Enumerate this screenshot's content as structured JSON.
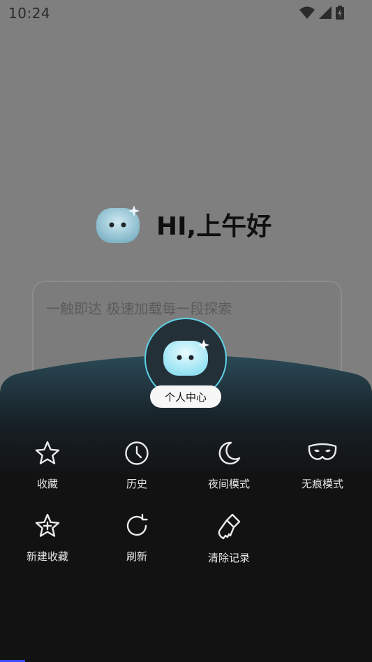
{
  "status_bar": {
    "time": "10:24"
  },
  "background": {
    "greeting": "HI,上午好",
    "search_placeholder": "一触即达 极速加载每一段探索"
  },
  "personal_center": {
    "label": "个人中心"
  },
  "menu": {
    "items": [
      {
        "label": "收藏",
        "icon": "star-icon"
      },
      {
        "label": "历史",
        "icon": "clock-icon"
      },
      {
        "label": "夜间模式",
        "icon": "moon-icon"
      },
      {
        "label": "无痕模式",
        "icon": "mask-icon"
      },
      {
        "label": "新建收藏",
        "icon": "star-plus-icon"
      },
      {
        "label": "刷新",
        "icon": "refresh-icon"
      },
      {
        "label": "清除记录",
        "icon": "broom-icon"
      }
    ]
  },
  "colors": {
    "panel": "#121212",
    "accent": "#5ed2e8",
    "overlay": "#7f7f7f"
  }
}
